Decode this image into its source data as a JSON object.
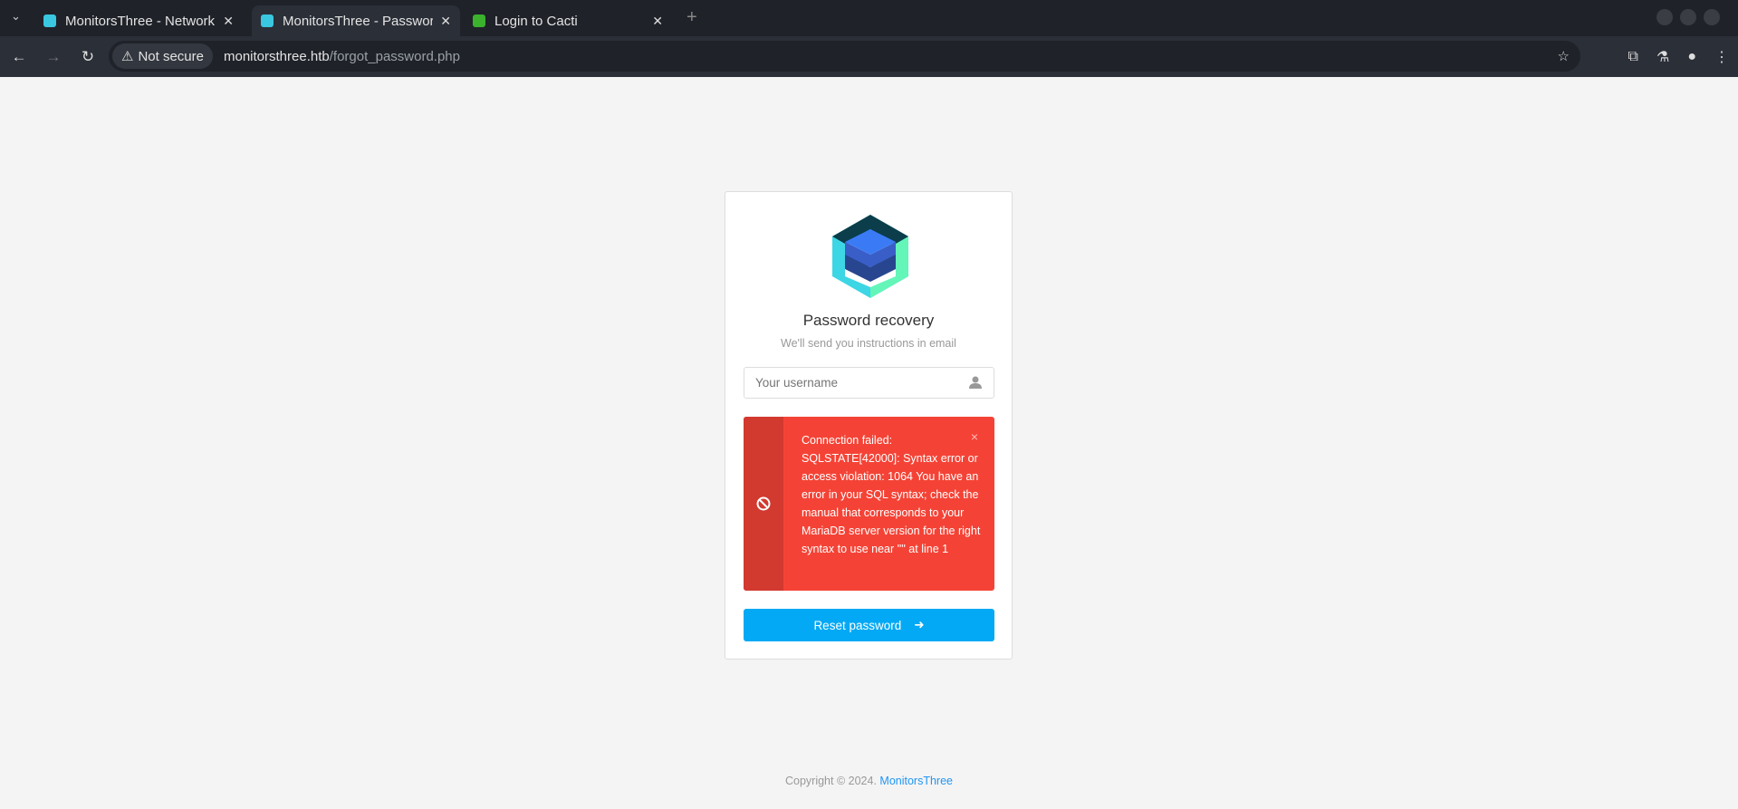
{
  "browser": {
    "tabs": [
      {
        "title": "MonitorsThree - Network",
        "active": false
      },
      {
        "title": "MonitorsThree - Password",
        "active": true
      },
      {
        "title": "Login to Cacti",
        "active": false
      }
    ],
    "security_label": "Not secure",
    "url_host": "monitorsthree.htb",
    "url_path": "/forgot_password.php"
  },
  "card": {
    "title": "Password recovery",
    "subtitle": "We'll send you instructions in email",
    "username_placeholder": "Your username",
    "error_message": "Connection failed: SQLSTATE[42000]: Syntax error or access violation: 1064 You have an error in your SQL syntax; check the manual that corresponds to your MariaDB server version for the right syntax to use near '\"' at line 1",
    "close_label": "×",
    "button_label": "Reset password"
  },
  "footer": {
    "copyright": "Copyright © 2024.",
    "link": "MonitorsThree"
  },
  "colors": {
    "alert": "#f44336",
    "button": "#03a9f4",
    "link": "#2196f3"
  }
}
